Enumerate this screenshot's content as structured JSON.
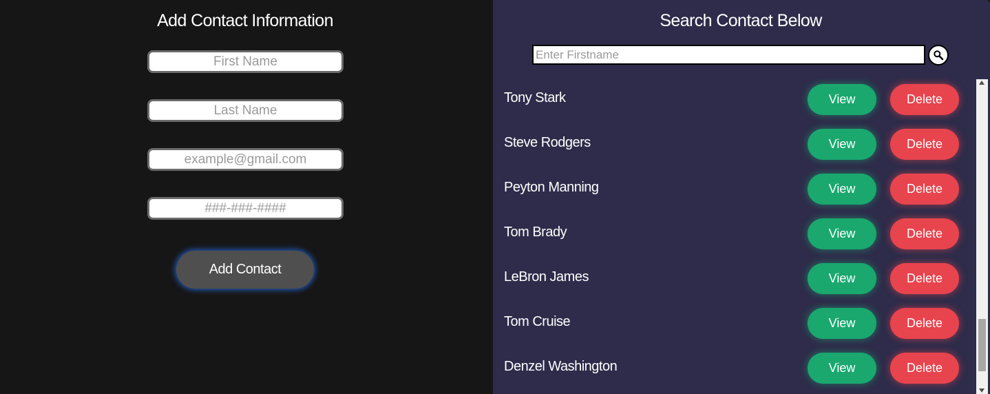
{
  "add_panel": {
    "title": "Add Contact Information",
    "first_name_placeholder": "First Name",
    "last_name_placeholder": "Last Name",
    "email_placeholder": "example@gmail.com",
    "phone_placeholder": "###-###-####",
    "add_button_label": "Add Contact"
  },
  "search_panel": {
    "title": "Search Contact Below",
    "search_placeholder": "Enter Firstname",
    "search_icon": "magnifier-icon"
  },
  "contacts": [
    {
      "name": "Tony Stark",
      "view_label": "View",
      "delete_label": "Delete"
    },
    {
      "name": "Steve Rodgers",
      "view_label": "View",
      "delete_label": "Delete"
    },
    {
      "name": "Peyton Manning",
      "view_label": "View",
      "delete_label": "Delete"
    },
    {
      "name": "Tom Brady",
      "view_label": "View",
      "delete_label": "Delete"
    },
    {
      "name": "LeBron James",
      "view_label": "View",
      "delete_label": "Delete"
    },
    {
      "name": "Tom Cruise",
      "view_label": "View",
      "delete_label": "Delete"
    },
    {
      "name": "Denzel Washington",
      "view_label": "View",
      "delete_label": "Delete"
    }
  ],
  "colors": {
    "left_background": "#161616",
    "right_background": "#2e2c4a",
    "view_button": "#1aa86f",
    "delete_button": "#e8444e",
    "add_button": "#4f4f4f",
    "add_button_glow": "#286ee6"
  }
}
